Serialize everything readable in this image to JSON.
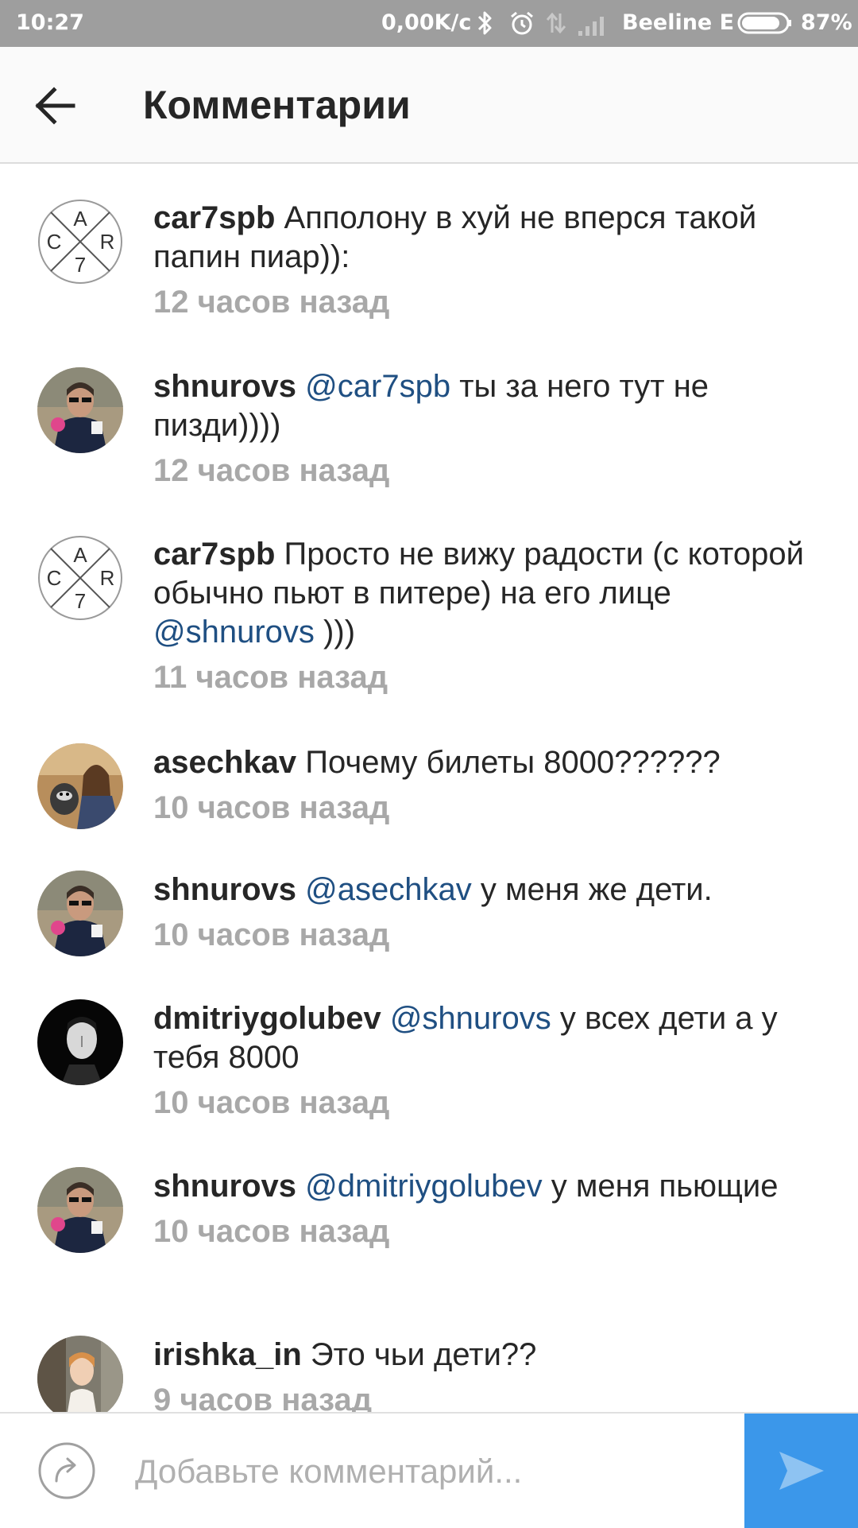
{
  "status_bar": {
    "time": "10:27",
    "network_speed": "0,00K/c",
    "carrier": "Beeline E",
    "battery_percent": "87%",
    "battery_level": 0.87
  },
  "header": {
    "title": "Комментарии"
  },
  "comments": [
    {
      "username": "car7spb",
      "mention": "",
      "text": "Апполону в хуй не вперся такой папин пиар)):",
      "text_after": "",
      "time": "12 часов назад"
    },
    {
      "username": "shnurovs",
      "mention": "@car7spb",
      "text": "ты за него тут не пизди))))",
      "text_after": "",
      "time": "12 часов назад"
    },
    {
      "username": "car7spb",
      "mention": "",
      "text": "Просто не вижу радости (с которой обычно пьют в питере) на его лице",
      "mention_after": "@shnurovs",
      "text_after": ")))",
      "time": "11 часов назад"
    },
    {
      "username": "asechkav",
      "mention": "",
      "text": "Почему билеты 8000??????",
      "text_after": "",
      "time": "10 часов назад"
    },
    {
      "username": "shnurovs",
      "mention": "@asechkav",
      "text": "у меня же дети.",
      "text_after": "",
      "time": "10 часов назад"
    },
    {
      "username": "dmitriygolubev",
      "mention": "@shnurovs",
      "text": "у всех дети а у тебя 8000",
      "text_after": "",
      "time": "10 часов назад"
    },
    {
      "username": "shnurovs",
      "mention": "@dmitriygolubev",
      "text": "у меня пьющие",
      "text_after": "",
      "time": "10 часов назад"
    },
    {
      "username": "irishka_in",
      "mention": "",
      "text": "Это чьи дети??",
      "text_after": "",
      "time": "9 часов назад"
    }
  ],
  "car7_logo_letters": [
    "A",
    "C",
    "R",
    "7"
  ],
  "composer": {
    "placeholder": "Добавьте комментарий..."
  },
  "colors": {
    "status_bar": "#9e9e9e",
    "mention": "#1f4f82",
    "send_button": "#3b97ea",
    "timestamp": "#a8a8a8"
  }
}
